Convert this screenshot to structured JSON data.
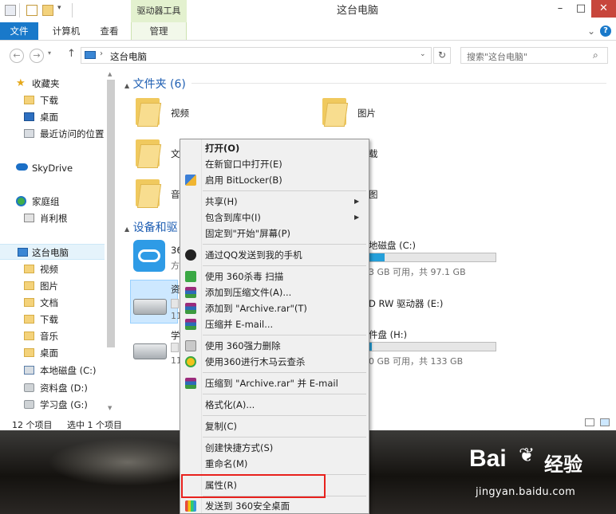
{
  "window": {
    "title": "这台电脑",
    "tool_tab_title": "驱动器工具",
    "controls": {
      "minimize": "–",
      "maximize": "□",
      "close": "✕"
    }
  },
  "ribbon": {
    "tabs": [
      "文件",
      "计算机",
      "查看",
      "管理"
    ],
    "collapse": "⌄",
    "help": "?"
  },
  "address": {
    "path": "这台电脑",
    "search_placeholder": "搜索\"这台电脑\""
  },
  "nav": {
    "favorites": "收藏夹",
    "favorites_items": [
      "下载",
      "桌面",
      "最近访问的位置"
    ],
    "skydrive": "SkyDrive",
    "homegroup": "家庭组",
    "homegroup_items": [
      "肖利根"
    ],
    "thispc": "这台电脑",
    "thispc_items": [
      "视频",
      "图片",
      "文档",
      "下载",
      "音乐",
      "桌面",
      "本地磁盘 (C:)",
      "资料盘 (D:)",
      "学习盘 (G:)"
    ]
  },
  "content": {
    "folders_header": "文件夹 (6)",
    "folders": [
      "视频",
      "图片",
      "文",
      "载",
      "音",
      "图"
    ],
    "devices_header": "设备和驱",
    "device_fragments": {
      "cloud_title": "36",
      "cloud_sub": "方",
      "drive_d_title": "资",
      "drive_d_sub": "11",
      "drive_g_title": "学",
      "drive_g_sub": "11"
    },
    "drives": [
      {
        "name": "地磁盘 (C:)",
        "info": "3 GB 可用，共 97.1 GB",
        "used_fraction": 0.12
      },
      {
        "name": "D RW 驱动器 (E:)",
        "info": ""
      },
      {
        "name": "件盘 (H:)",
        "info": "0 GB 可用，共 133 GB",
        "used_fraction": 0.02
      }
    ]
  },
  "status": {
    "items": "12 个项目",
    "selected": "选中 1 个项目"
  },
  "context_menu": {
    "items": [
      {
        "label": "打开(O)",
        "bold": true
      },
      {
        "label": "在新窗口中打开(E)"
      },
      {
        "label": "启用 BitLocker(B)",
        "icon": "shield-icon"
      },
      {
        "label": "共享(H)",
        "submenu": true
      },
      {
        "label": "包含到库中(I)",
        "submenu": true
      },
      {
        "label": "固定到\"开始\"屏幕(P)"
      },
      {
        "label": "通过QQ发送到我的手机",
        "icon": "qq-icon"
      },
      {
        "label": "使用 360杀毒 扫描",
        "icon": "360-antivirus-icon"
      },
      {
        "label": "添加到压缩文件(A)...",
        "icon": "winrar-icon"
      },
      {
        "label": "添加到 \"Archive.rar\"(T)",
        "icon": "winrar-icon"
      },
      {
        "label": "压缩并 E-mail...",
        "icon": "winrar-icon"
      },
      {
        "label": "使用 360强力删除",
        "icon": "shredder-icon"
      },
      {
        "label": "使用360进行木马云查杀",
        "icon": "360-scan-icon"
      },
      {
        "label": "压缩到 \"Archive.rar\" 并 E-mail",
        "icon": "winrar-icon"
      },
      {
        "label": "格式化(A)..."
      },
      {
        "label": "复制(C)"
      },
      {
        "label": "创建快捷方式(S)"
      },
      {
        "label": "重命名(M)"
      },
      {
        "label": "属性(R)"
      },
      {
        "label": "发送到 360安全桌面",
        "icon": "360-desktop-icon"
      }
    ]
  },
  "watermark": {
    "logo": "Bai",
    "logo_tail": "经验",
    "url": "jingyan.baidu.com"
  },
  "colors": {
    "file_tab": "#1979ca",
    "tool_tab": "#e3f1cf",
    "header_blue": "#1f5fb3",
    "capacity_fill": "#26a0da",
    "highlight_red": "#e8211d"
  }
}
